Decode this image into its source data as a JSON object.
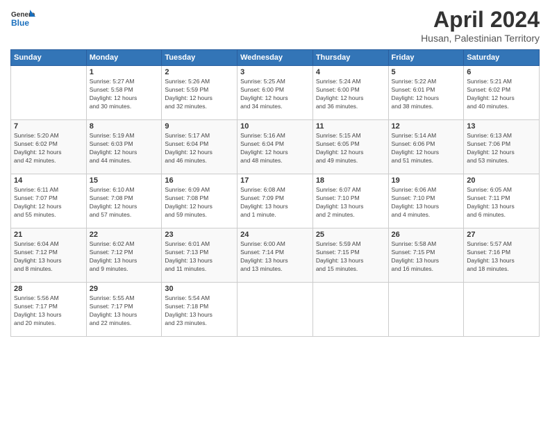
{
  "header": {
    "logo_line1": "General",
    "logo_line2": "Blue",
    "month_title": "April 2024",
    "subtitle": "Husan, Palestinian Territory"
  },
  "days_of_week": [
    "Sunday",
    "Monday",
    "Tuesday",
    "Wednesday",
    "Thursday",
    "Friday",
    "Saturday"
  ],
  "weeks": [
    [
      {
        "num": "",
        "info": ""
      },
      {
        "num": "1",
        "info": "Sunrise: 5:27 AM\nSunset: 5:58 PM\nDaylight: 12 hours\nand 30 minutes."
      },
      {
        "num": "2",
        "info": "Sunrise: 5:26 AM\nSunset: 5:59 PM\nDaylight: 12 hours\nand 32 minutes."
      },
      {
        "num": "3",
        "info": "Sunrise: 5:25 AM\nSunset: 6:00 PM\nDaylight: 12 hours\nand 34 minutes."
      },
      {
        "num": "4",
        "info": "Sunrise: 5:24 AM\nSunset: 6:00 PM\nDaylight: 12 hours\nand 36 minutes."
      },
      {
        "num": "5",
        "info": "Sunrise: 5:22 AM\nSunset: 6:01 PM\nDaylight: 12 hours\nand 38 minutes."
      },
      {
        "num": "6",
        "info": "Sunrise: 5:21 AM\nSunset: 6:02 PM\nDaylight: 12 hours\nand 40 minutes."
      }
    ],
    [
      {
        "num": "7",
        "info": "Sunrise: 5:20 AM\nSunset: 6:02 PM\nDaylight: 12 hours\nand 42 minutes."
      },
      {
        "num": "8",
        "info": "Sunrise: 5:19 AM\nSunset: 6:03 PM\nDaylight: 12 hours\nand 44 minutes."
      },
      {
        "num": "9",
        "info": "Sunrise: 5:17 AM\nSunset: 6:04 PM\nDaylight: 12 hours\nand 46 minutes."
      },
      {
        "num": "10",
        "info": "Sunrise: 5:16 AM\nSunset: 6:04 PM\nDaylight: 12 hours\nand 48 minutes."
      },
      {
        "num": "11",
        "info": "Sunrise: 5:15 AM\nSunset: 6:05 PM\nDaylight: 12 hours\nand 49 minutes."
      },
      {
        "num": "12",
        "info": "Sunrise: 5:14 AM\nSunset: 6:06 PM\nDaylight: 12 hours\nand 51 minutes."
      },
      {
        "num": "13",
        "info": "Sunrise: 6:13 AM\nSunset: 7:06 PM\nDaylight: 12 hours\nand 53 minutes."
      }
    ],
    [
      {
        "num": "14",
        "info": "Sunrise: 6:11 AM\nSunset: 7:07 PM\nDaylight: 12 hours\nand 55 minutes."
      },
      {
        "num": "15",
        "info": "Sunrise: 6:10 AM\nSunset: 7:08 PM\nDaylight: 12 hours\nand 57 minutes."
      },
      {
        "num": "16",
        "info": "Sunrise: 6:09 AM\nSunset: 7:08 PM\nDaylight: 12 hours\nand 59 minutes."
      },
      {
        "num": "17",
        "info": "Sunrise: 6:08 AM\nSunset: 7:09 PM\nDaylight: 13 hours\nand 1 minute."
      },
      {
        "num": "18",
        "info": "Sunrise: 6:07 AM\nSunset: 7:10 PM\nDaylight: 13 hours\nand 2 minutes."
      },
      {
        "num": "19",
        "info": "Sunrise: 6:06 AM\nSunset: 7:10 PM\nDaylight: 13 hours\nand 4 minutes."
      },
      {
        "num": "20",
        "info": "Sunrise: 6:05 AM\nSunset: 7:11 PM\nDaylight: 13 hours\nand 6 minutes."
      }
    ],
    [
      {
        "num": "21",
        "info": "Sunrise: 6:04 AM\nSunset: 7:12 PM\nDaylight: 13 hours\nand 8 minutes."
      },
      {
        "num": "22",
        "info": "Sunrise: 6:02 AM\nSunset: 7:12 PM\nDaylight: 13 hours\nand 9 minutes."
      },
      {
        "num": "23",
        "info": "Sunrise: 6:01 AM\nSunset: 7:13 PM\nDaylight: 13 hours\nand 11 minutes."
      },
      {
        "num": "24",
        "info": "Sunrise: 6:00 AM\nSunset: 7:14 PM\nDaylight: 13 hours\nand 13 minutes."
      },
      {
        "num": "25",
        "info": "Sunrise: 5:59 AM\nSunset: 7:15 PM\nDaylight: 13 hours\nand 15 minutes."
      },
      {
        "num": "26",
        "info": "Sunrise: 5:58 AM\nSunset: 7:15 PM\nDaylight: 13 hours\nand 16 minutes."
      },
      {
        "num": "27",
        "info": "Sunrise: 5:57 AM\nSunset: 7:16 PM\nDaylight: 13 hours\nand 18 minutes."
      }
    ],
    [
      {
        "num": "28",
        "info": "Sunrise: 5:56 AM\nSunset: 7:17 PM\nDaylight: 13 hours\nand 20 minutes."
      },
      {
        "num": "29",
        "info": "Sunrise: 5:55 AM\nSunset: 7:17 PM\nDaylight: 13 hours\nand 22 minutes."
      },
      {
        "num": "30",
        "info": "Sunrise: 5:54 AM\nSunset: 7:18 PM\nDaylight: 13 hours\nand 23 minutes."
      },
      {
        "num": "",
        "info": ""
      },
      {
        "num": "",
        "info": ""
      },
      {
        "num": "",
        "info": ""
      },
      {
        "num": "",
        "info": ""
      }
    ]
  ]
}
